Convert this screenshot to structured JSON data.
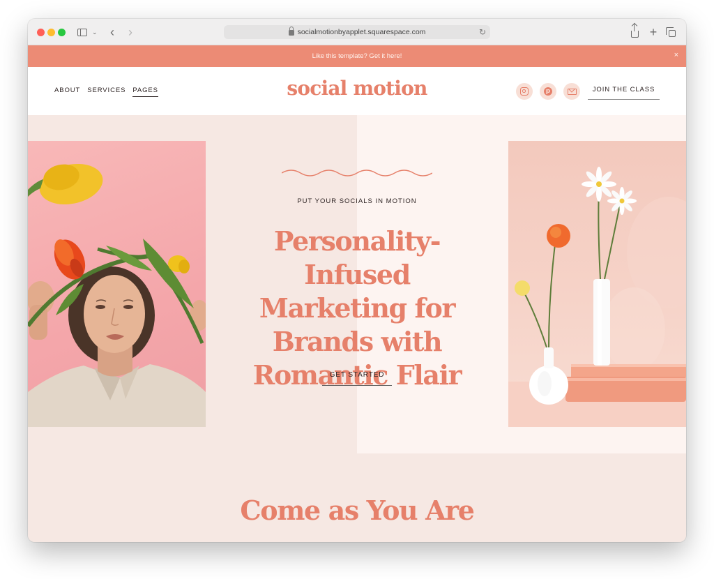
{
  "browser": {
    "url": "socialmotionbyapplet.squarespace.com",
    "icons": [
      "sidebar-icon",
      "chevron-down-icon",
      "back-icon",
      "forward-icon",
      "lock-icon",
      "reload-icon",
      "share-icon",
      "plus-icon",
      "tabs-icon"
    ]
  },
  "announcement": {
    "text": "Like this template? Get it here!",
    "close": "×"
  },
  "header": {
    "nav": [
      {
        "label": "ABOUT",
        "active": false
      },
      {
        "label": "SERVICES",
        "active": false
      },
      {
        "label": "PAGES",
        "active": true
      }
    ],
    "logo": "social motion",
    "social_icons": [
      "instagram-icon",
      "pinterest-icon",
      "mail-icon"
    ],
    "cta": "JOIN THE CLASS"
  },
  "hero": {
    "eyebrow": "PUT YOUR SOCIALS IN MOTION",
    "headline": "Personality-Infused Marketing for Brands with Romantic Flair",
    "cta": "GET STARTED"
  },
  "section": {
    "title": "Come as You Are"
  },
  "colors": {
    "accent": "#e6806a",
    "announcement_bg": "#ec8b75",
    "hero_bg": "#f6e8e3",
    "hero_panel_bg": "#fdf4f1",
    "text_dark": "#2d2323"
  }
}
